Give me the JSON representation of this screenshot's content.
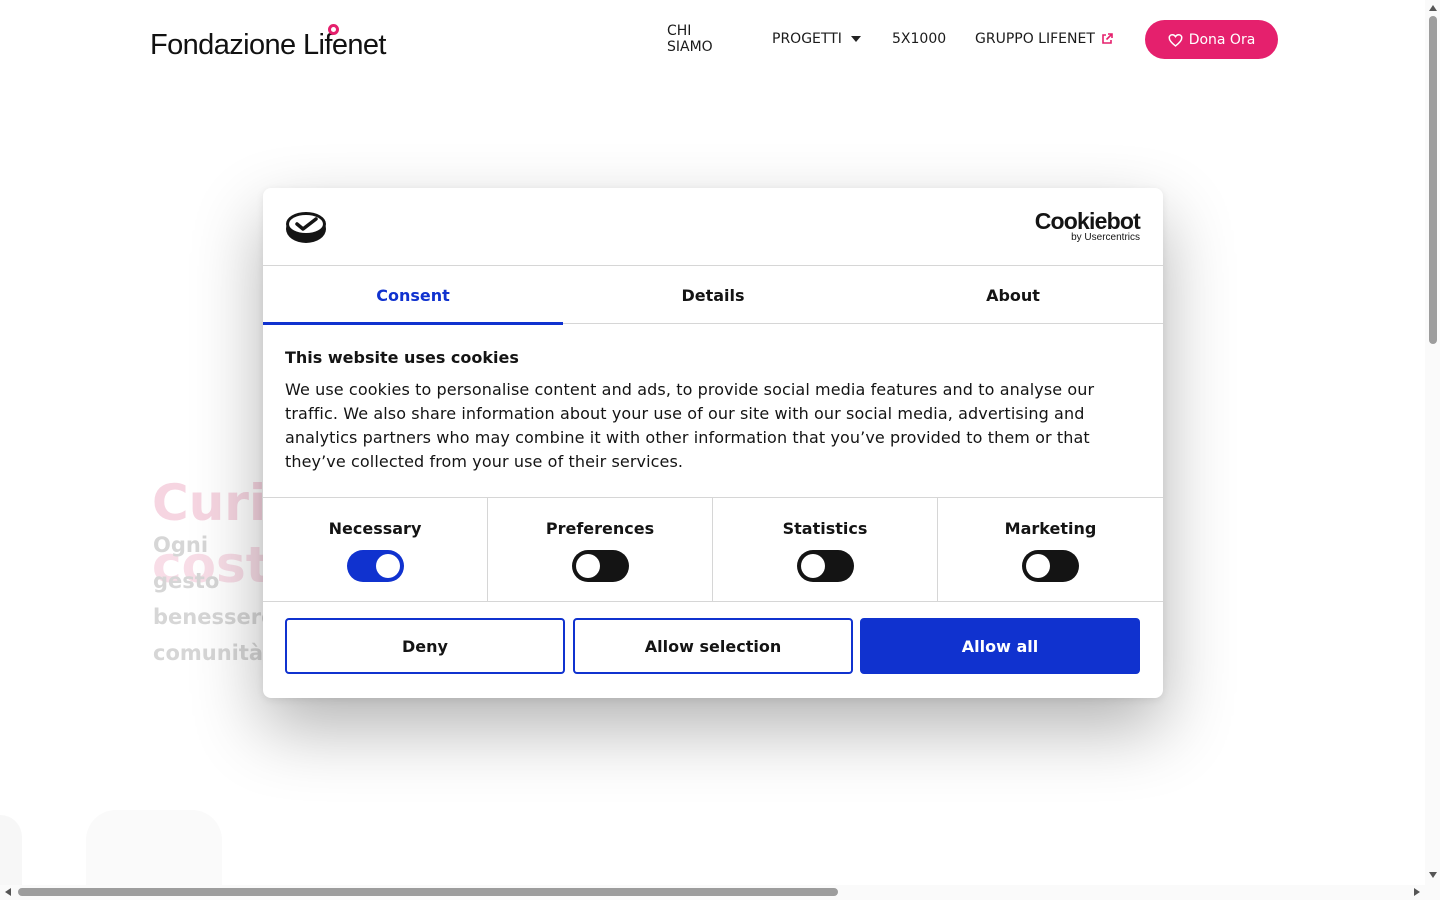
{
  "site": {
    "logo_text": "Fondazione Lifenet",
    "nav": [
      {
        "label": "CHI SIAMO"
      },
      {
        "label": "PROGETTI"
      },
      {
        "label": "5X1000"
      },
      {
        "label": "GRUPPO LIFENET"
      }
    ],
    "donate_label": "Dona Ora",
    "hero_title_line1": "Curia",
    "hero_title_line2": "costr",
    "hero_sub": "Ogni gesto benessere comunità."
  },
  "dialog": {
    "brand_main": "Cookiebot",
    "brand_sub": "by Usercentrics",
    "tabs": [
      {
        "label": "Consent",
        "active": true
      },
      {
        "label": "Details",
        "active": false
      },
      {
        "label": "About",
        "active": false
      }
    ],
    "title": "This website uses cookies",
    "text": "We use cookies to personalise content and ads, to provide social media features and to analyse our traffic. We also share information about your use of our site with our social media, advertising and analytics partners who may combine it with other information that you’ve provided to them or that they’ve collected from your use of their services.",
    "toggles": [
      {
        "label": "Necessary",
        "on": true
      },
      {
        "label": "Preferences",
        "on": false
      },
      {
        "label": "Statistics",
        "on": false
      },
      {
        "label": "Marketing",
        "on": false
      }
    ],
    "buttons": {
      "deny": "Deny",
      "allow_selection": "Allow selection",
      "allow_all": "Allow all"
    }
  },
  "colors": {
    "brand_pink": "#e5206d",
    "cookiebot_blue": "#1032cf",
    "text_dark": "#141414"
  }
}
